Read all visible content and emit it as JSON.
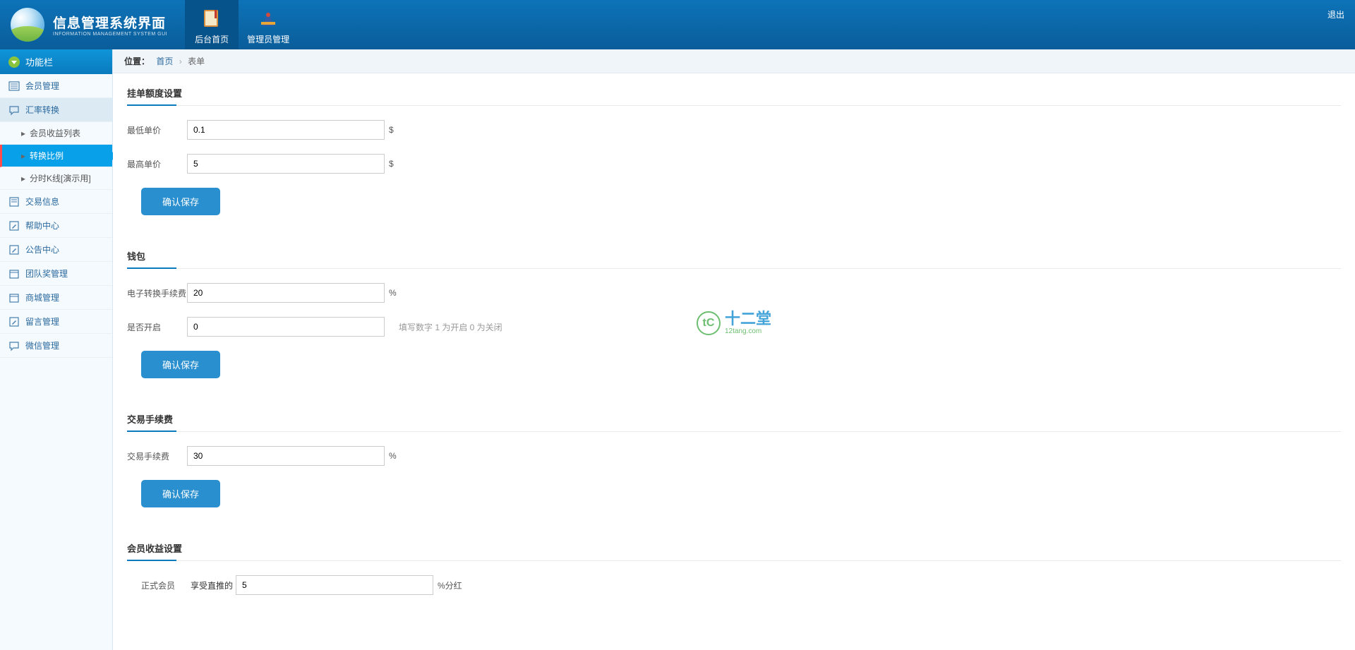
{
  "header": {
    "title_main": "信息管理系统界面",
    "title_sub": "INFORMATION MANAGEMENT SYSTEM GUI",
    "logout": "退出"
  },
  "top_nav": [
    {
      "label": "后台首页",
      "active": true
    },
    {
      "label": "管理员管理",
      "active": false
    }
  ],
  "sidebar": {
    "title": "功能栏",
    "items": [
      {
        "label": "会员管理"
      },
      {
        "label": "汇率转换"
      },
      {
        "label": "交易信息"
      },
      {
        "label": "帮助中心"
      },
      {
        "label": "公告中心"
      },
      {
        "label": "团队奖管理"
      },
      {
        "label": "商城管理"
      },
      {
        "label": "留言管理"
      },
      {
        "label": "微信管理"
      }
    ],
    "sub_exchange": [
      {
        "label": "会员收益列表"
      },
      {
        "label": "转换比例"
      },
      {
        "label": "分时K线[演示用]"
      }
    ]
  },
  "breadcrumb": {
    "label": "位置：",
    "home": "首页",
    "current": "表单"
  },
  "sections": {
    "s1": {
      "title": "挂单额度设置",
      "row1_label": "最低单价",
      "row1_value": "0.1",
      "row1_unit": "$",
      "row2_label": "最高单价",
      "row2_value": "5",
      "row2_unit": "$",
      "save": "确认保存"
    },
    "s2": {
      "title": "钱包",
      "row1_label": "电子转换手续费",
      "row1_value": "20",
      "row1_unit": "%",
      "row2_label": "是否开启",
      "row2_value": "0",
      "row2_hint": "填写数字 1 为开启 0 为关闭",
      "save": "确认保存"
    },
    "s3": {
      "title": "交易手续费",
      "row1_label": "交易手续费",
      "row1_value": "30",
      "row1_unit": "%",
      "save": "确认保存"
    },
    "s4": {
      "title": "会员收益设置",
      "row1_label": "正式会员",
      "row1_prefix": "享受直推的",
      "row1_value": "5",
      "row1_suffix": "%分红"
    }
  },
  "watermark": {
    "t1": "十二堂",
    "t2": "12tang.com"
  }
}
